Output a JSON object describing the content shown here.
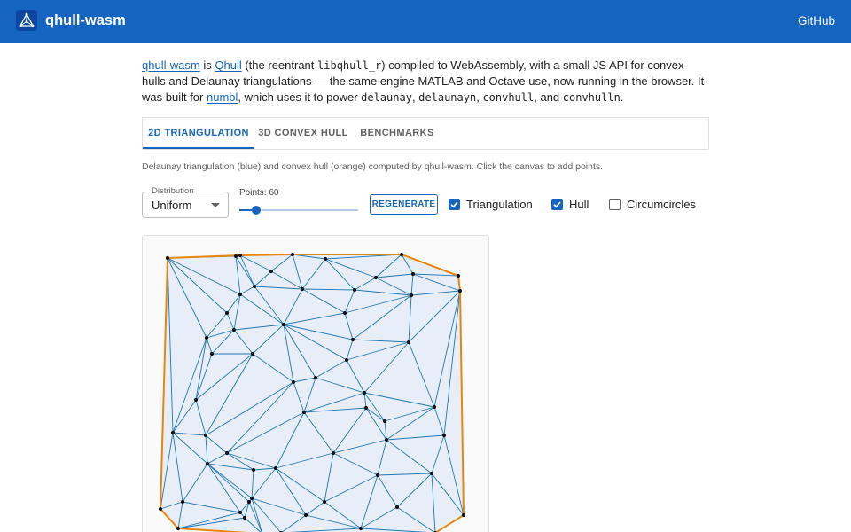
{
  "header": {
    "title": "qhull-wasm",
    "github_label": "GitHub"
  },
  "intro": {
    "p1_link_self": "qhull-wasm",
    "p1_text_is": " is ",
    "p1_link_qhull": "Qhull",
    "p1_text_reentrant": " (the reentrant ",
    "p1_code_lib": "libqhull_r",
    "p1_text_compiled": ") compiled to WebAssembly, with a small JS API for convex hulls and Delaunay triangulations — the same engine MATLAB and Octave use, now running in the browser. It was built for ",
    "p1_link_numbl": "numbl",
    "p1_text_uses": ", which uses it to power ",
    "code_delaunay": "delaunay",
    "sep1": ", ",
    "code_delaunayn": "delaunayn",
    "sep2": ", ",
    "code_convhull": "convhull",
    "sep3": ", and ",
    "code_convhulln": "convhulln",
    "end": "."
  },
  "tabs": [
    {
      "label": "2D TRIANGULATION",
      "active": true
    },
    {
      "label": "3D CONVEX HULL",
      "active": false
    },
    {
      "label": "BENCHMARKS",
      "active": false
    }
  ],
  "caption": "Delaunay triangulation (blue) and convex hull (orange) computed by qhull-wasm. Click the canvas to add points.",
  "controls": {
    "distribution_label": "Distribution",
    "distribution_value": "Uniform",
    "points_label": "Points: 60",
    "points_value": 60,
    "points_fraction": 0.14,
    "regenerate_label": "REGENERATE",
    "toggles": [
      {
        "label": "Triangulation",
        "checked": true
      },
      {
        "label": "Hull",
        "checked": true
      },
      {
        "label": "Circumcircles",
        "checked": false
      }
    ]
  },
  "colors": {
    "appbar": "#1565c0",
    "accent": "#1565c0",
    "triangulation_edge": "#1f77b4",
    "hull_edge": "#e8860c",
    "fill": "#e8eef7",
    "point": "#111111"
  },
  "icons": {
    "logo": "triangle-mesh-icon",
    "dropdown": "caret-down-icon",
    "checkbox_on": "check-icon"
  }
}
